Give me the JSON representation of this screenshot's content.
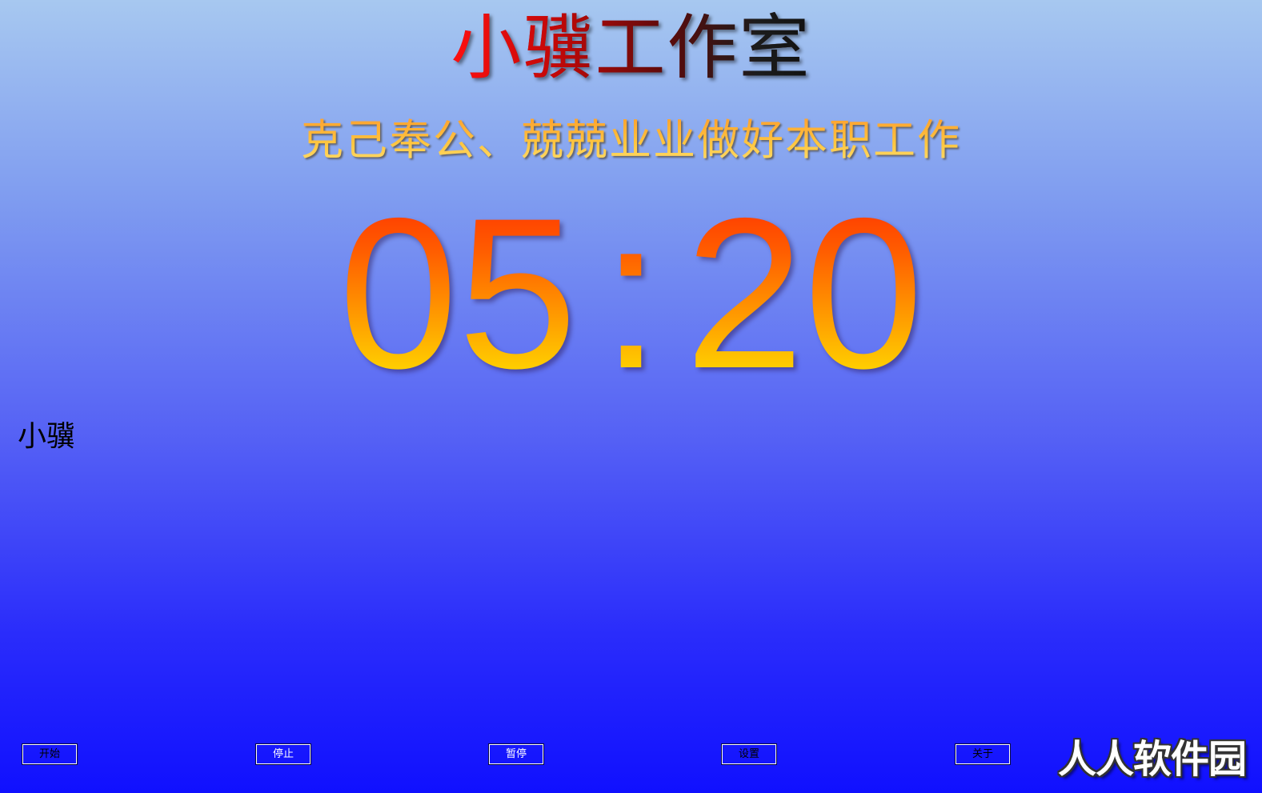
{
  "header": {
    "title": "小骥工作室",
    "slogan": "克己奉公、兢兢业业做好本职工作"
  },
  "timer": {
    "minutes": "05",
    "separator": ":",
    "seconds": "20"
  },
  "name_label": "小骥",
  "toolbar": {
    "start_label": "开始",
    "stop_label": "停止",
    "pause_label": "暂停",
    "settings_label": "设置",
    "about_label": "关于"
  },
  "watermark": "人人软件园",
  "colors": {
    "background_top": "#a7c8f0",
    "background_bottom": "#1010ff",
    "title_start": "#ff1010",
    "title_end": "#111111",
    "slogan": "#ffc640",
    "timer_top": "#ff2a00",
    "timer_bottom": "#ffe000"
  }
}
